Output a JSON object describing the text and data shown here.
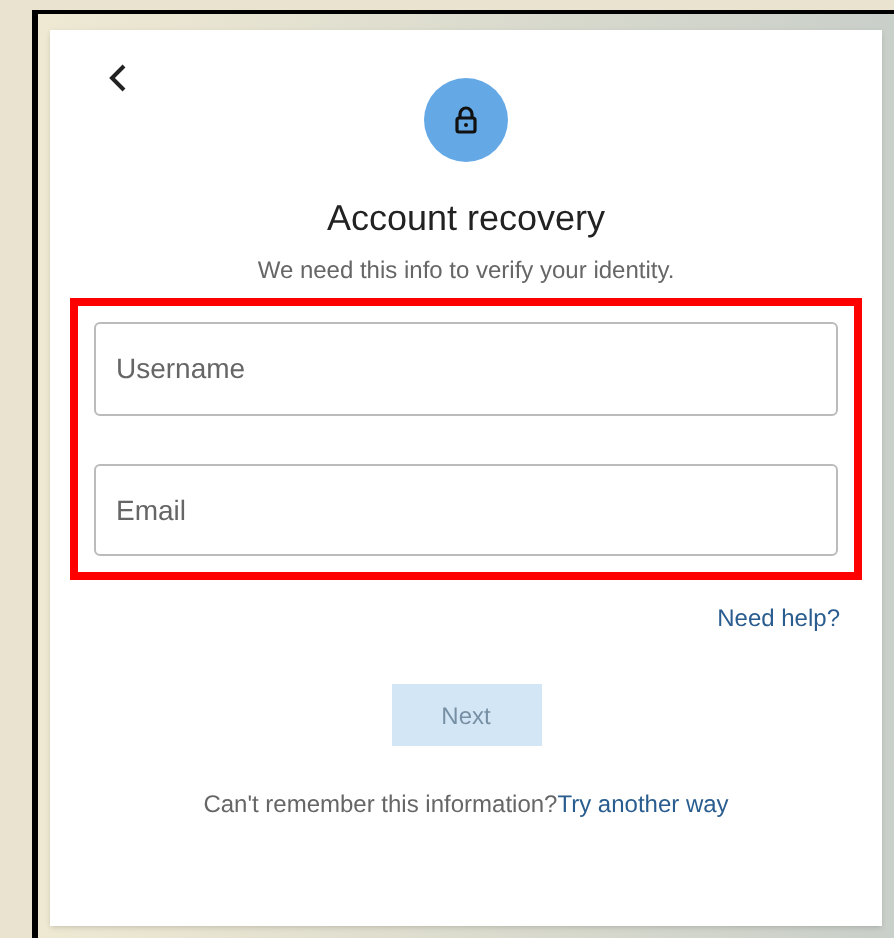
{
  "title": "Account recovery",
  "subtitle": "We need this info to verify your identity.",
  "highlighted": true,
  "fields": [
    {
      "placeholder": "Username"
    },
    {
      "placeholder": "Email"
    }
  ],
  "help_link": "Need help?",
  "next_button": {
    "label": "Next",
    "disabled": true
  },
  "footer": {
    "text": "Can't remember this information?",
    "link": "Try another way"
  }
}
